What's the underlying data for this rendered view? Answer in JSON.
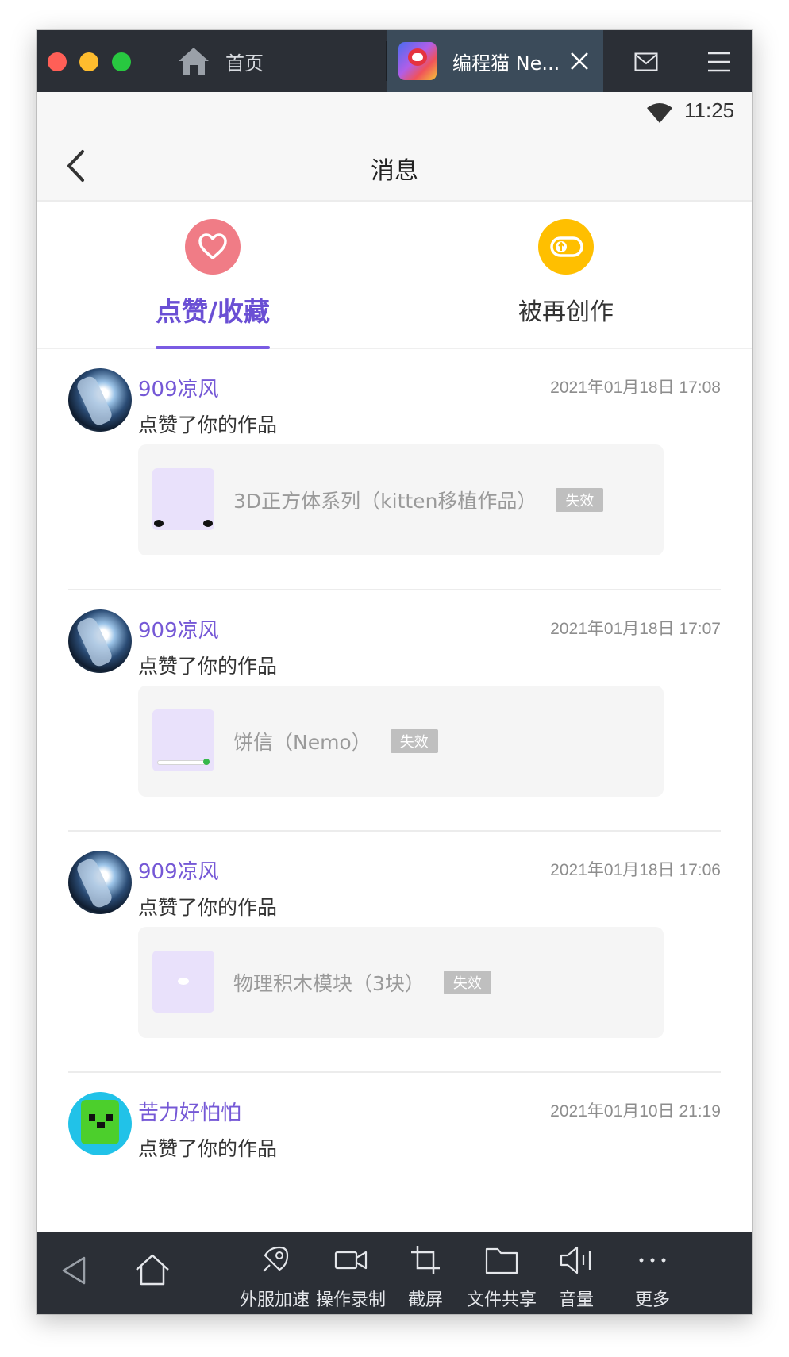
{
  "titlebar": {
    "home_tab_label": "首页",
    "active_tab_title": "编程猫 Ne..."
  },
  "status": {
    "time": "11:25"
  },
  "header": {
    "title": "消息"
  },
  "tabs": [
    {
      "label": "点赞/收藏",
      "icon": "heart-icon",
      "color": "#f07c86",
      "active": true
    },
    {
      "label": "被再创作",
      "icon": "remix-icon",
      "color": "#ffbf00",
      "active": false
    }
  ],
  "messages": [
    {
      "user": "909凉风",
      "time": "2021年01月18日 17:08",
      "action": "点赞了你的作品",
      "work": "3D正方体系列（kitten移植作品）",
      "badge": "失效"
    },
    {
      "user": "909凉风",
      "time": "2021年01月18日 17:07",
      "action": "点赞了你的作品",
      "work": "饼信（Nemo）",
      "badge": "失效"
    },
    {
      "user": "909凉风",
      "time": "2021年01月18日 17:06",
      "action": "点赞了你的作品",
      "work": "物理积木模块（3块）",
      "badge": "失效"
    },
    {
      "user": "苦力好怕怕",
      "time": "2021年01月10日 21:19",
      "action": "点赞了你的作品"
    }
  ],
  "toolbar": {
    "items": [
      {
        "label": "外服加速",
        "icon": "rocket-icon"
      },
      {
        "label": "操作录制",
        "icon": "video-camera-icon"
      },
      {
        "label": "截屏",
        "icon": "crop-icon"
      },
      {
        "label": "文件共享",
        "icon": "folder-icon"
      },
      {
        "label": "音量",
        "icon": "speaker-icon"
      },
      {
        "label": "更多",
        "icon": "more-icon"
      }
    ]
  },
  "colors": {
    "accent": "#7558d6",
    "titlebar": "#2b2f36",
    "active_tab": "#3b4b5a"
  }
}
